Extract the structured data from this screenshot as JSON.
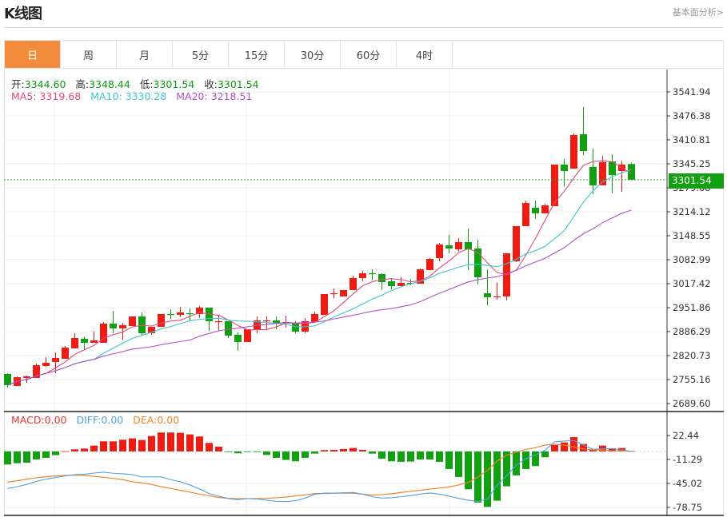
{
  "header": {
    "title": "K线图",
    "link": "基本面分析>"
  },
  "tabs": [
    {
      "label": "日",
      "active": true
    },
    {
      "label": "周"
    },
    {
      "label": "月"
    },
    {
      "label": "5分"
    },
    {
      "label": "15分"
    },
    {
      "label": "30分"
    },
    {
      "label": "60分"
    },
    {
      "label": "4时"
    }
  ],
  "ohlc_legend": {
    "open_label": "开:",
    "open": "3344.60",
    "high_label": "高:",
    "high": "3348.44",
    "low_label": "低:",
    "low": "3301.54",
    "close_label": "收:",
    "close": "3301.54"
  },
  "ma_legend": {
    "ma5": "MA5: 3319.68",
    "ma10": "MA10: 3330.28",
    "ma20": "MA20: 3218.51"
  },
  "macd_legend": {
    "macd": "MACD:0.00",
    "diff": "DIFF:0.00",
    "dea": "DEA:0.00"
  },
  "current_price": "3301.54",
  "colors": {
    "up": "#EE1C12",
    "down": "#10A010",
    "ma5": "#E4487E",
    "ma10": "#3CC6D2",
    "ma20": "#B050C8",
    "diff": "#4FA3E4",
    "dea": "#F0842A",
    "tab_active": "#F28C3C"
  },
  "chart_data": [
    {
      "type": "candlestick",
      "title": "",
      "price_ticks": [
        "3541.94",
        "3476.38",
        "3410.81",
        "3345.25",
        "3279.68",
        "3214.12",
        "3148.55",
        "3082.99",
        "3017.42",
        "2951.86",
        "2886.29",
        "2820.73",
        "2755.16",
        "2689.60"
      ],
      "ylim": [
        2689.6,
        3541.94
      ],
      "grid": true,
      "ohlc": [
        [
          2770.5,
          2772.7,
          2733.3,
          2739.9
        ],
        [
          2737.7,
          2763.9,
          2737.7,
          2761.7
        ],
        [
          2759.6,
          2766.1,
          2746.4,
          2763.9
        ],
        [
          2759.6,
          2798.9,
          2759.6,
          2794.5
        ],
        [
          2792.3,
          2816.4,
          2790.2,
          2801.1
        ],
        [
          2803.3,
          2829.5,
          2772.7,
          2814.2
        ],
        [
          2812.0,
          2847.0,
          2812.0,
          2842.6
        ],
        [
          2840.4,
          2881.9,
          2840.4,
          2868.8
        ],
        [
          2866.7,
          2873.2,
          2836.1,
          2855.7
        ],
        [
          2855.7,
          2886.3,
          2855.7,
          2862.3
        ],
        [
          2855.7,
          2912.5,
          2855.7,
          2908.2
        ],
        [
          2908.2,
          2943.1,
          2881.9,
          2895.1
        ],
        [
          2895.1,
          2910.4,
          2864.5,
          2903.8
        ],
        [
          2901.6,
          2927.8,
          2901.6,
          2927.8
        ],
        [
          2927.8,
          2938.8,
          2877.6,
          2881.9
        ],
        [
          2881.9,
          2899.4,
          2877.6,
          2899.4
        ],
        [
          2899.4,
          2934.4,
          2899.4,
          2934.4
        ],
        [
          2934.4,
          2947.5,
          2921.3,
          2932.2
        ],
        [
          2932.2,
          2954.1,
          2925.7,
          2938.8
        ],
        [
          2936.6,
          2949.7,
          2916.9,
          2934.4
        ],
        [
          2934.4,
          2956.3,
          2923.5,
          2951.9
        ],
        [
          2951.9,
          2951.9,
          2888.5,
          2914.7
        ],
        [
          2912.5,
          2930.0,
          2890.7,
          2914.7
        ],
        [
          2914.7,
          2914.7,
          2868.8,
          2875.4
        ],
        [
          2877.6,
          2884.1,
          2833.9,
          2857.9
        ],
        [
          2857.9,
          2892.9,
          2857.9,
          2892.9
        ],
        [
          2890.7,
          2927.8,
          2881.9,
          2916.9
        ],
        [
          2914.7,
          2927.8,
          2892.9,
          2916.9
        ],
        [
          2916.9,
          2927.8,
          2892.9,
          2910.4
        ],
        [
          2910.4,
          2930.0,
          2897.2,
          2912.5
        ],
        [
          2910.4,
          2914.7,
          2881.9,
          2886.3
        ],
        [
          2886.3,
          2923.5,
          2881.9,
          2914.7
        ],
        [
          2912.5,
          2941.0,
          2912.5,
          2934.4
        ],
        [
          2932.2,
          2989.0,
          2932.2,
          2989.0
        ],
        [
          2989.0,
          3004.3,
          2978.1,
          2991.2
        ],
        [
          2982.5,
          3000.0,
          2982.5,
          3000.0
        ],
        [
          3000.0,
          3039.3,
          3000.0,
          3032.8
        ],
        [
          3032.8,
          3052.4,
          3024.0,
          3045.9
        ],
        [
          3045.9,
          3056.8,
          3026.2,
          3043.7
        ],
        [
          3043.7,
          3045.9,
          3000.0,
          3021.8
        ],
        [
          3024.0,
          3032.8,
          3002.2,
          3010.9
        ],
        [
          3010.9,
          3034.9,
          3010.9,
          3019.6
        ],
        [
          3019.6,
          3030.6,
          3013.1,
          3017.5
        ],
        [
          3017.5,
          3059.0,
          3017.5,
          3056.8
        ],
        [
          3054.6,
          3087.4,
          3054.6,
          3085.2
        ],
        [
          3087.4,
          3128.9,
          3078.6,
          3124.5
        ],
        [
          3122.4,
          3150.8,
          3100.5,
          3113.6
        ],
        [
          3111.4,
          3142.0,
          3104.9,
          3131.1
        ],
        [
          3131.1,
          3168.2,
          3054.6,
          3111.4
        ],
        [
          3113.6,
          3137.7,
          3015.3,
          3034.9
        ],
        [
          2991.2,
          3056.8,
          2958.4,
          2980.3
        ],
        [
          2980.3,
          3019.6,
          2973.7,
          2982.5
        ],
        [
          2982.5,
          3100.5,
          2971.6,
          3100.5
        ],
        [
          3078.6,
          3174.8,
          3076.4,
          3174.8
        ],
        [
          3174.8,
          3244.7,
          3174.8,
          3238.2
        ],
        [
          3225.1,
          3244.7,
          3194.5,
          3209.8
        ],
        [
          3209.8,
          3236.0,
          3209.8,
          3231.6
        ],
        [
          3229.4,
          3343.1,
          3229.4,
          3343.1
        ],
        [
          3343.1,
          3358.4,
          3284.1,
          3325.6
        ],
        [
          3332.2,
          3428.3,
          3332.2,
          3423.9
        ],
        [
          3426.1,
          3500.4,
          3369.3,
          3380.2
        ],
        [
          3336.5,
          3386.8,
          3262.2,
          3286.3
        ],
        [
          3286.3,
          3367.1,
          3286.3,
          3349.6
        ],
        [
          3351.8,
          3371.5,
          3264.4,
          3314.7
        ],
        [
          3325.6,
          3354.0,
          3268.8,
          3343.1
        ],
        [
          3344.6,
          3348.44,
          3301.54,
          3301.54
        ]
      ],
      "moving_averages": [
        5,
        10,
        20
      ]
    },
    {
      "type": "bar+line",
      "title": "",
      "ticks": [
        "22.44",
        "-11.29",
        "-45.02",
        "-78.75"
      ],
      "ylim": [
        -78.75,
        22.44
      ],
      "macd": [
        -18.4,
        -16.5,
        -15.7,
        -11.2,
        -9.0,
        -5.2,
        0.3,
        3.0,
        4.1,
        8.2,
        14.2,
        14.2,
        16.5,
        18.4,
        16.1,
        21.7,
        26.6,
        26.6,
        26.2,
        24.0,
        21.0,
        12.0,
        6.7,
        -0.4,
        -2.6,
        -0.2,
        -0.1,
        -4.9,
        -9.0,
        -12.0,
        -13.9,
        -9.0,
        -3.0,
        1.9,
        2.2,
        3.4,
        4.9,
        2.2,
        -3.0,
        -10.1,
        -13.9,
        -14.6,
        -14.2,
        -11.2,
        -11.2,
        -14.6,
        -24.7,
        -36.0,
        -53.2,
        -72.0,
        -78.0,
        -69.3,
        -49.1,
        -33.7,
        -24.7,
        -20.6,
        -8.2,
        9.0,
        12.7,
        20.2,
        10.5,
        3.0,
        8.2,
        4.5,
        4.9,
        0.5
      ],
      "diff": [
        -52.1,
        -49.5,
        -46.5,
        -42.0,
        -39.0,
        -36.7,
        -34.5,
        -32.6,
        -32.2,
        -30.4,
        -29.2,
        -30.7,
        -31.5,
        -32.6,
        -36.0,
        -35.6,
        -36.0,
        -39.7,
        -42.7,
        -47.2,
        -52.8,
        -59.2,
        -63.0,
        -66.3,
        -67.8,
        -66.3,
        -67.1,
        -68.6,
        -70.1,
        -70.5,
        -69.3,
        -65.6,
        -60.3,
        -58.5,
        -58.5,
        -58.1,
        -57.7,
        -60.0,
        -63.7,
        -65.6,
        -65.2,
        -63.7,
        -62.2,
        -60.0,
        -58.5,
        -60.0,
        -63.0,
        -66.0,
        -68.6,
        -70.5,
        -67.1,
        -47.6,
        -34.1,
        -19.1,
        -10.1,
        -4.9,
        1.9,
        13.5,
        14.6,
        15.4,
        9.0,
        3.0,
        3.7,
        4.1,
        2.2,
        0
      ],
      "dea": [
        -43.1,
        -41.2,
        -39.0,
        -37.1,
        -35.6,
        -34.5,
        -33.7,
        -33.4,
        -33.7,
        -34.9,
        -36.4,
        -37.9,
        -39.7,
        -42.7,
        -44.2,
        -46.5,
        -49.5,
        -52.1,
        -54.7,
        -57.3,
        -60.0,
        -62.2,
        -64.8,
        -66.0,
        -66.3,
        -66.3,
        -66.3,
        -66.0,
        -65.2,
        -64.1,
        -62.6,
        -61.1,
        -59.2,
        -59.2,
        -58.8,
        -58.5,
        -58.8,
        -60.0,
        -61.5,
        -60.7,
        -59.6,
        -57.7,
        -56.2,
        -54.7,
        -52.8,
        -51.7,
        -49.8,
        -47.2,
        -43.5,
        -36.0,
        -26.6,
        -13.5,
        -5.2,
        -1.1,
        3.0,
        5.2,
        9.0,
        10.1,
        9.0,
        6.4,
        3.7,
        2.2,
        1.9,
        1.1,
        0.7,
        0
      ]
    }
  ]
}
